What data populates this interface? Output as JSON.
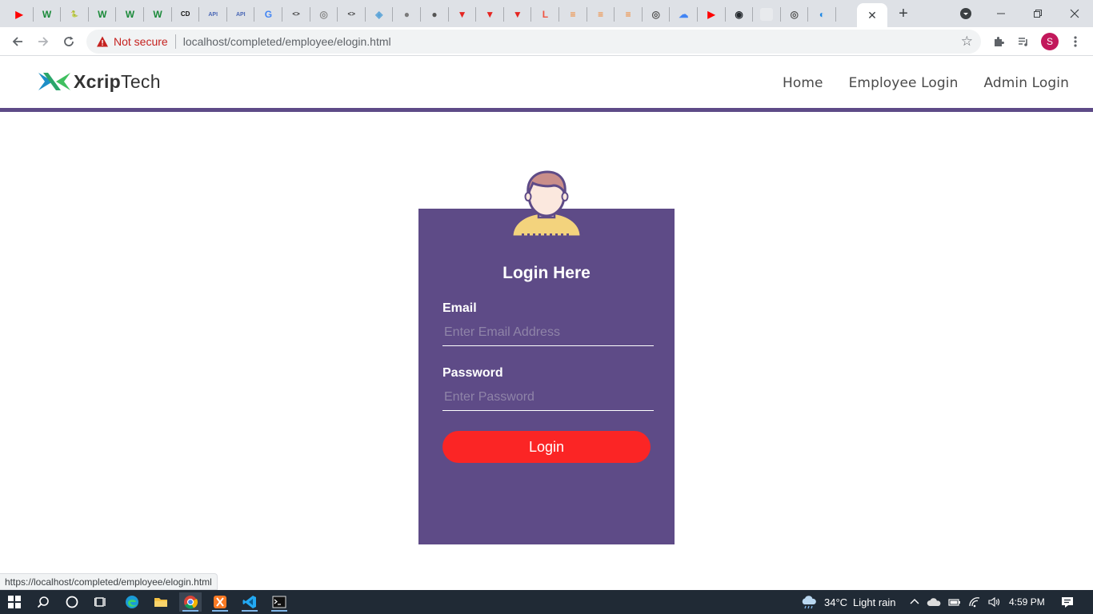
{
  "browser": {
    "tab_close_glyph": "✕",
    "new_tab_glyph": "+",
    "favicons": [
      {
        "name": "youtube-favicon",
        "color": "#ff0000",
        "glyph": "▶"
      },
      {
        "name": "w-favicon",
        "color": "#1b8a3a",
        "glyph": "W"
      },
      {
        "name": "python-favicon",
        "color": "#3773a5",
        "glyph": "🐍"
      },
      {
        "name": "w-favicon",
        "color": "#1b8a3a",
        "glyph": "W"
      },
      {
        "name": "w-favicon",
        "color": "#1b8a3a",
        "glyph": "W"
      },
      {
        "name": "w-favicon",
        "color": "#1b8a3a",
        "glyph": "W"
      },
      {
        "name": "cd-favicon",
        "color": "#111111",
        "glyph": "CD"
      },
      {
        "name": "api-favicon",
        "color": "#4a67b5",
        "glyph": "API"
      },
      {
        "name": "api-favicon",
        "color": "#4a67b5",
        "glyph": "API"
      },
      {
        "name": "google-favicon",
        "color": "#4285f4",
        "glyph": "G"
      },
      {
        "name": "code-favicon",
        "color": "#2f2f2f",
        "glyph": "<>"
      },
      {
        "name": "chrome-favicon",
        "color": "#8a8a8a",
        "glyph": "◎"
      },
      {
        "name": "code-favicon",
        "color": "#2f2f2f",
        "glyph": "<>"
      },
      {
        "name": "shield-favicon",
        "color": "#5aa3d8",
        "glyph": "◈"
      },
      {
        "name": "globe-favicon",
        "color": "#7a7a7a",
        "glyph": "●"
      },
      {
        "name": "globe-favicon",
        "color": "#555555",
        "glyph": "●"
      },
      {
        "name": "v-favicon",
        "color": "#e52521",
        "glyph": "▼"
      },
      {
        "name": "v-favicon",
        "color": "#e52521",
        "glyph": "▼"
      },
      {
        "name": "v-favicon",
        "color": "#e52521",
        "glyph": "▼"
      },
      {
        "name": "laravel-favicon",
        "color": "#f05340",
        "glyph": "L"
      },
      {
        "name": "stack-favicon",
        "color": "#f48024",
        "glyph": "≡"
      },
      {
        "name": "stack-favicon",
        "color": "#f48024",
        "glyph": "≡"
      },
      {
        "name": "stack-favicon",
        "color": "#f48024",
        "glyph": "≡"
      },
      {
        "name": "chrome-favicon",
        "color": "#555555",
        "glyph": "◎"
      },
      {
        "name": "cloud-favicon",
        "color": "#4285f4",
        "glyph": "☁"
      },
      {
        "name": "youtube-favicon",
        "color": "#ff0000",
        "glyph": "▶"
      },
      {
        "name": "github-favicon",
        "color": "#24292e",
        "glyph": "◉"
      },
      {
        "name": "blank-favicon",
        "color": "#e8eaed",
        "glyph": ""
      },
      {
        "name": "chrome-favicon",
        "color": "#555555",
        "glyph": "◎"
      },
      {
        "name": "edge-favicon",
        "color": "#1e88e5",
        "glyph": "◐"
      }
    ],
    "address": {
      "security_label": "Not secure",
      "url": "localhost/completed/employee/elogin.html"
    },
    "profile_initial": "S",
    "status_url": "https://localhost/completed/employee/elogin.html"
  },
  "site": {
    "logo": {
      "text_bold": "Xcrip",
      "text_light": "Tech"
    },
    "nav": [
      {
        "label": "Home"
      },
      {
        "label": "Employee Login"
      },
      {
        "label": "Admin Login"
      }
    ],
    "accent_color": "#5e4b87"
  },
  "login": {
    "title": "Login Here",
    "email_label": "Email",
    "email_placeholder": "Enter Email Address",
    "password_label": "Password",
    "password_placeholder": "Enter Password",
    "button_label": "Login",
    "button_color": "#fb2525"
  },
  "taskbar": {
    "weather_temp": "34°C",
    "weather_text": "Light rain",
    "time": "4:59 PM"
  }
}
